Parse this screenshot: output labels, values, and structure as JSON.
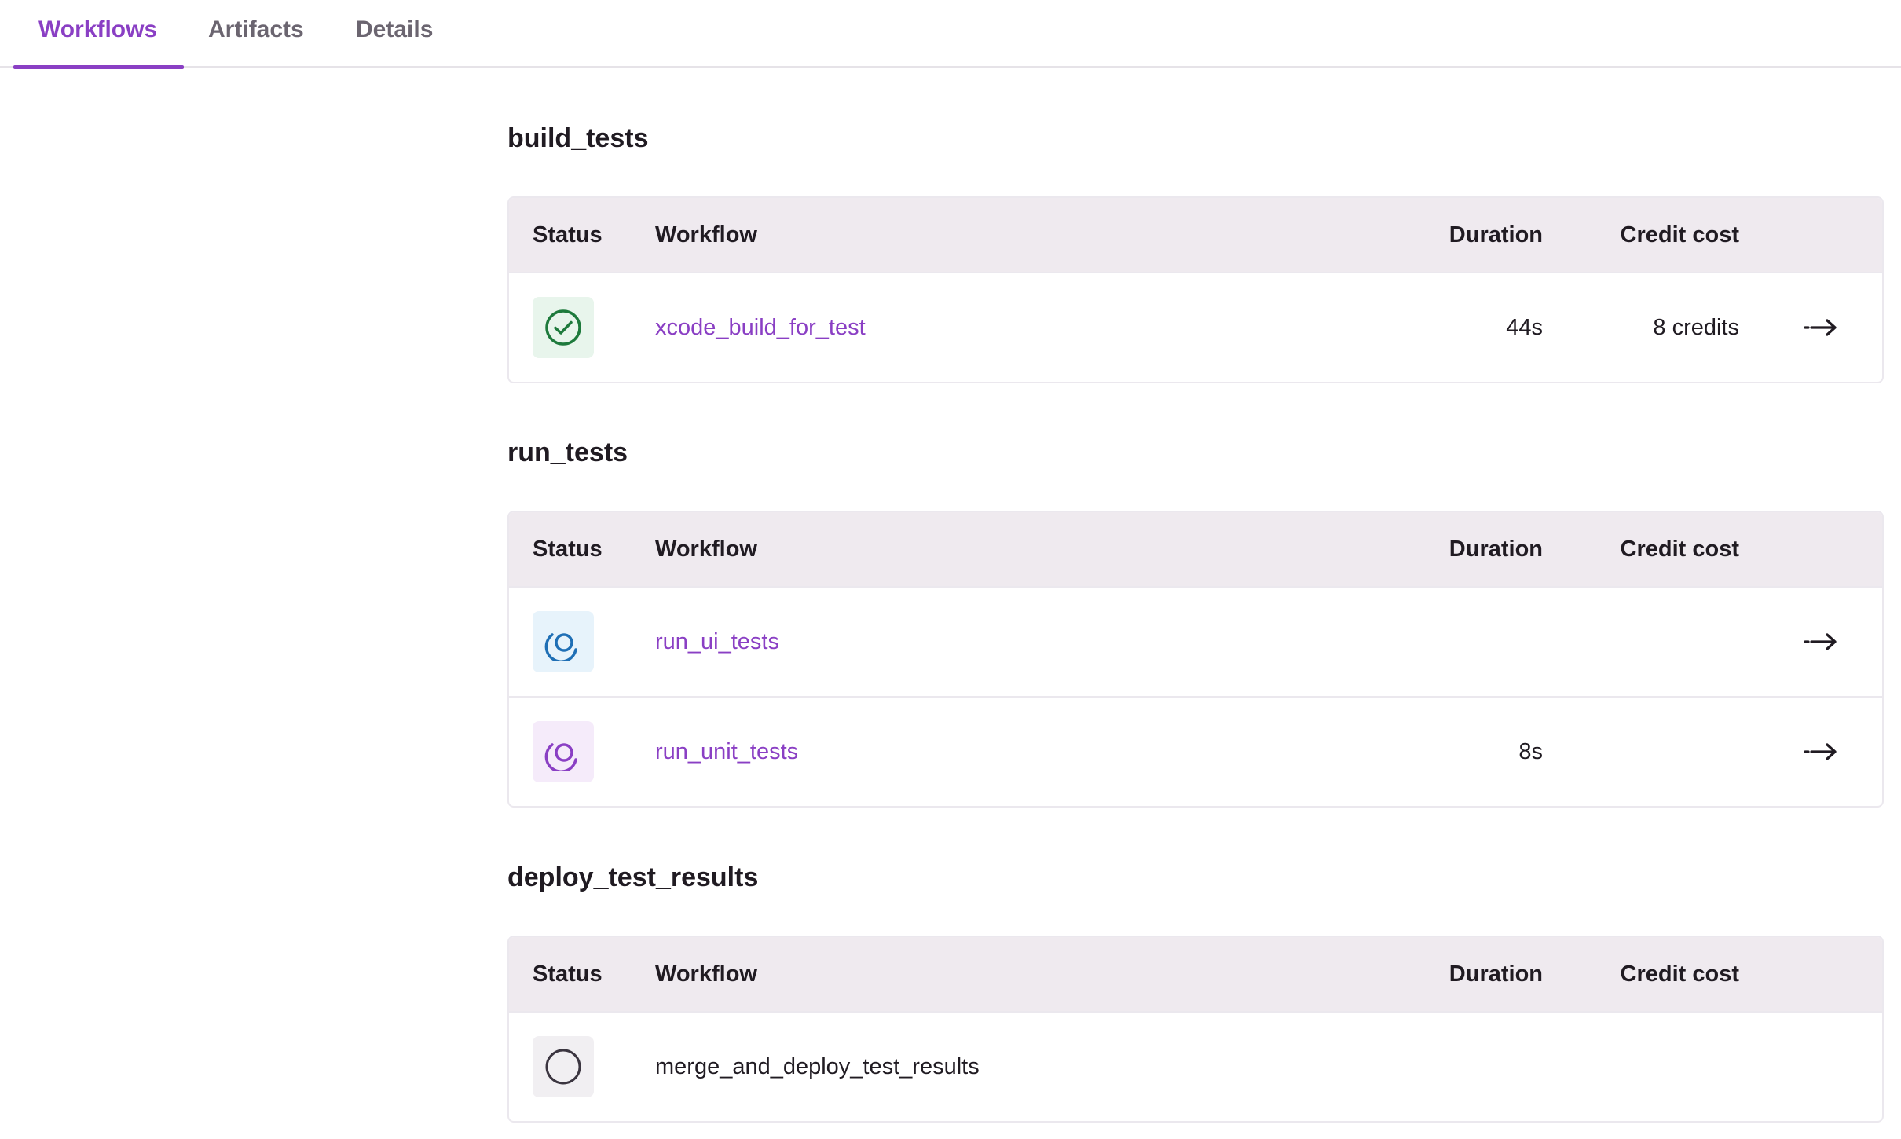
{
  "tabs": [
    {
      "label": "Workflows",
      "active": true
    },
    {
      "label": "Artifacts",
      "active": false
    },
    {
      "label": "Details",
      "active": false
    }
  ],
  "columns": {
    "status": "Status",
    "workflow": "Workflow",
    "duration": "Duration",
    "credit_cost": "Credit cost"
  },
  "groups": [
    {
      "title": "build_tests",
      "rows": [
        {
          "status": "success",
          "workflow": "xcode_build_for_test",
          "duration": "44s",
          "credit_cost": "8 credits",
          "link": true,
          "arrow": true
        }
      ]
    },
    {
      "title": "run_tests",
      "rows": [
        {
          "status": "running",
          "workflow": "run_ui_tests",
          "duration": "",
          "credit_cost": "",
          "link": true,
          "arrow": true
        },
        {
          "status": "running",
          "workflow": "run_unit_tests",
          "duration": "8s",
          "credit_cost": "",
          "link": true,
          "arrow": true
        }
      ]
    },
    {
      "title": "deploy_test_results",
      "rows": [
        {
          "status": "pending",
          "workflow": "merge_and_deploy_test_results",
          "duration": "",
          "credit_cost": "",
          "link": false,
          "arrow": false
        }
      ]
    }
  ],
  "colors": {
    "accent": "#8a3fc4",
    "success": "#1e7a3c",
    "running_blue": "#1f6fb5",
    "running_purple": "#8a3fc4",
    "pending": "#3b3540"
  },
  "icons": {
    "success": "check-circle-icon",
    "running": "spinner-icon",
    "pending": "empty-circle-icon",
    "arrow": "arrow-right-icon"
  }
}
